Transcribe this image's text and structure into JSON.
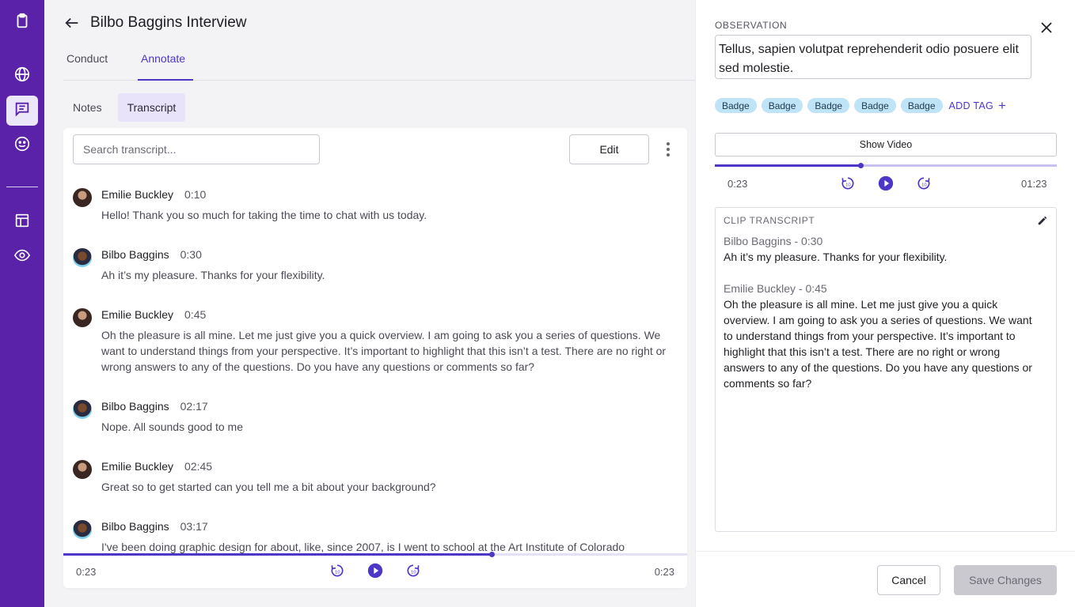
{
  "rail": {
    "items": [
      {
        "icon": "clipboard-icon",
        "active": false
      },
      {
        "icon": "globe-icon",
        "active": false
      },
      {
        "icon": "chat-icon",
        "active": true
      },
      {
        "icon": "smiley-icon",
        "active": false
      },
      {
        "icon": "layout-icon",
        "active": false
      },
      {
        "icon": "eye-icon",
        "active": false
      }
    ],
    "background": "#5a22a8",
    "active_bg": "#ece6fb"
  },
  "header": {
    "title": "Bilbo Baggins Interview",
    "tabs": [
      {
        "label": "Conduct",
        "active": false
      },
      {
        "label": "Annotate",
        "active": true
      }
    ]
  },
  "subtabs": [
    {
      "label": "Notes",
      "active": false
    },
    {
      "label": "Transcript",
      "active": true
    }
  ],
  "transcript": {
    "search_placeholder": "Search transcript...",
    "edit_label": "Edit",
    "messages": [
      {
        "speaker": "Emilie Buckley",
        "time": "0:10",
        "text": "Hello! Thank you so much for taking the time to chat with us today.",
        "avatar": "emilie"
      },
      {
        "speaker": "Bilbo Baggins",
        "time": "0:30",
        "text": "Ah it’s my pleasure. Thanks for your flexibility.",
        "avatar": "bilbo"
      },
      {
        "speaker": "Emilie Buckley",
        "time": "0:45",
        "text": "Oh the pleasure is all mine. Let me just give you a quick overview. I am going to ask you a series of questions. We want to understand things from your perspective. It’s important to highlight that this isn’t a test. There are no right or wrong answers to any of the questions. Do you have any questions or comments so far?",
        "avatar": "emilie"
      },
      {
        "speaker": "Bilbo Baggins",
        "time": "02:17",
        "text": "Nope. All sounds good to me",
        "avatar": "bilbo"
      },
      {
        "speaker": "Emilie Buckley",
        "time": "02:45",
        "text": "Great so to get started can you tell me a bit about your background?",
        "avatar": "emilie"
      },
      {
        "speaker": "Bilbo Baggins",
        "time": "03:17",
        "text": "I've been doing graphic design for about, like, since 2007, is I went to school at the Art Institute of Colorado",
        "avatar": "bilbo"
      }
    ],
    "player": {
      "current": "0:23",
      "total": "0:23",
      "progress": 0.687
    }
  },
  "panel": {
    "observation_label": "OBSERVATION",
    "observation_text": "Tellus, sapien volutpat reprehenderit odio posuere elit sed molestie.",
    "tags": [
      "Badge",
      "Badge",
      "Badge",
      "Badge",
      "Badge"
    ],
    "add_tag_label": "ADD TAG",
    "show_video_label": "Show Video",
    "player": {
      "current": "0:23",
      "total": "01:23",
      "progress": 0.426
    },
    "clip": {
      "label": "CLIP TRANSCRIPT",
      "entries": [
        {
          "speaker": "Bilbo Baggins - 0:30",
          "text": "Ah it’s my pleasure. Thanks for your flexibility."
        },
        {
          "speaker": "Emilie Buckley - 0:45",
          "text": "Oh the pleasure is all mine. Let me just give you a quick overview. I am going to ask you a series of questions. We want to understand things from your perspective. It’s important to highlight that this isn’t a test. There are no right or wrong answers to any of the questions. Do you have any questions or comments so far?"
        }
      ]
    },
    "cancel_label": "Cancel",
    "save_label": "Save Changes"
  },
  "colors": {
    "accent": "#4c37c7",
    "badge_bg": "#bfe3f7",
    "save_disabled_bg": "#c9c9cf"
  }
}
